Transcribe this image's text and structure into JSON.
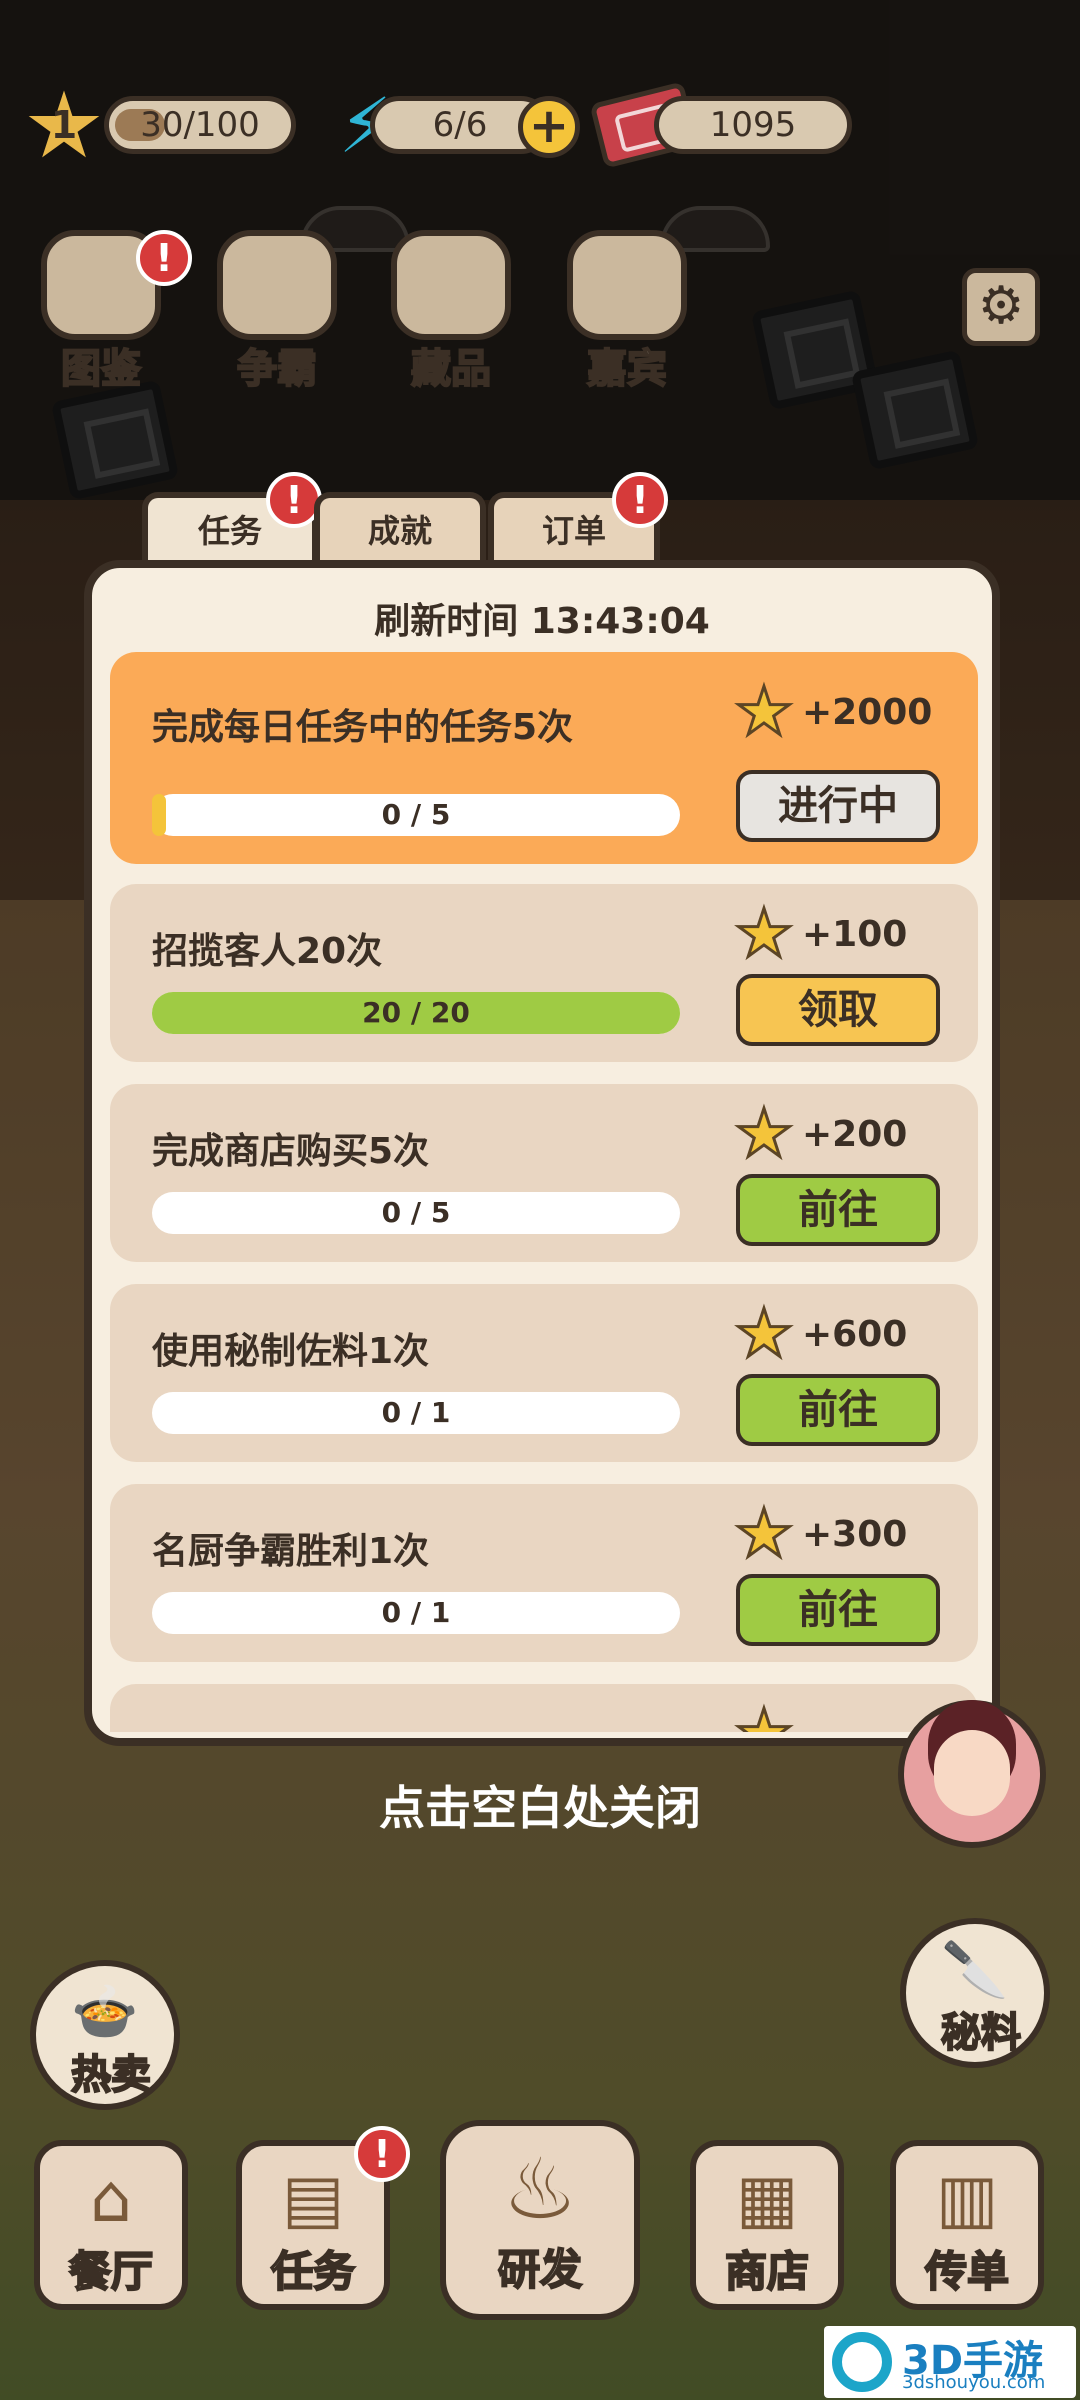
{
  "hud": {
    "level": "1",
    "xp": "30/100",
    "energy": "6/6",
    "cash": "1095"
  },
  "top_icons": [
    {
      "label": "图鉴",
      "alert": "!"
    },
    {
      "label": "争霸"
    },
    {
      "label": "藏品"
    },
    {
      "label": "嘉宾"
    }
  ],
  "tabs": [
    {
      "label": "任务",
      "alert": "!"
    },
    {
      "label": "成就"
    },
    {
      "label": "订单",
      "alert": "!"
    }
  ],
  "refresh": "刷新时间 13:43:04",
  "tasks": [
    {
      "title": "完成每日任务中的任务5次",
      "reward": "+2000",
      "progress": "0 / 5",
      "progress_fraction": 0,
      "button": "进行中",
      "state": "in_progress"
    },
    {
      "title": "招揽客人20次",
      "reward": "+100",
      "progress": "20 / 20",
      "progress_fraction": 1,
      "button": "领取",
      "state": "claim"
    },
    {
      "title": "完成商店购买5次",
      "reward": "+200",
      "progress": "0 / 5",
      "progress_fraction": 0,
      "button": "前往",
      "state": "go"
    },
    {
      "title": "使用秘制佐料1次",
      "reward": "+600",
      "progress": "0 / 1",
      "progress_fraction": 0,
      "button": "前往",
      "state": "go"
    },
    {
      "title": "名厨争霸胜利1次",
      "reward": "+300",
      "progress": "0 / 1",
      "progress_fraction": 0,
      "button": "前往",
      "state": "go"
    }
  ],
  "close_hint": "点击空白处关闭",
  "side": {
    "hot_sale": "热卖",
    "secret": "秘料"
  },
  "nav": [
    {
      "label": "餐厅"
    },
    {
      "label": "任务",
      "alert": "!"
    },
    {
      "label": "研发"
    },
    {
      "label": "商店"
    },
    {
      "label": "传单"
    }
  ],
  "watermark": {
    "name": "3D手游网",
    "url": "3dshouyou.com"
  },
  "colors": {
    "outline": "#3b2f25",
    "active_task": "#fbaa57",
    "task_bg": "#e9d6c2",
    "go_button": "#9fcb44",
    "claim_button": "#f7c552",
    "alert": "#d63a3a"
  }
}
